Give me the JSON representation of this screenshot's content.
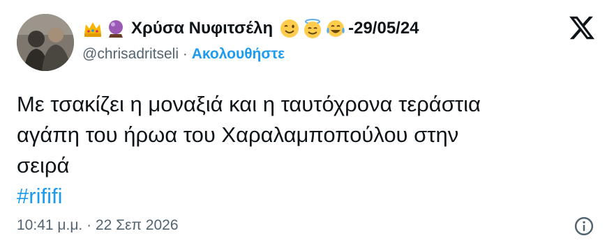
{
  "author": {
    "emoji_prefix": [
      "crown-emoji",
      "crystal-ball-emoji"
    ],
    "display_name": "Χρύσα Νυφιτσέλη",
    "emoji_suffix": [
      "winking-face-emoji",
      "smiling-face-with-halo-emoji",
      "face-with-tears-of-joy-emoji"
    ],
    "name_suffix": "-29/05/24",
    "handle": "@chrisadritseli",
    "separator": "·",
    "follow_label": "Ακολουθήστε"
  },
  "tweet": {
    "text_lines": [
      "Με τσακίζει η μοναξιά και η ταυτόχρονα τεράστια",
      "αγάπη του ήρωα του Χαραλαμποπούλου στην",
      "σειρά"
    ],
    "hashtag": "#rififi"
  },
  "footer": {
    "timestamp": "10:41 μ.μ. · 22 Σεπ 2026"
  },
  "icons": {
    "logo": "x-logo-icon",
    "info": "info-icon"
  },
  "colors": {
    "link": "#1d9bf0",
    "secondary_text": "#536471",
    "primary_text": "#0f1419"
  }
}
